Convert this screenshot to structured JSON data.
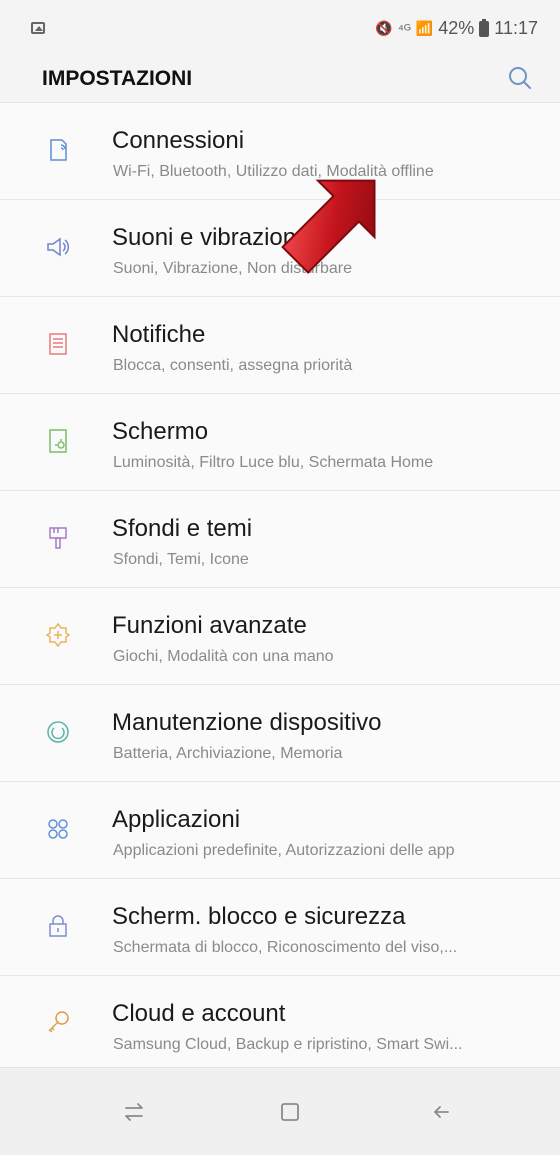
{
  "status_bar": {
    "left_icon": "image-notification-icon",
    "mute_icon": "mute-icon",
    "signal_label": "⁴ᴳ",
    "signal_icon": "signal-icon",
    "battery": "42%",
    "battery_icon": "battery-icon",
    "time": "11:17"
  },
  "header": {
    "title": "IMPOSTAZIONI",
    "search_icon": "search-icon"
  },
  "settings": [
    {
      "title": "Connessioni",
      "subtitle": "Wi-Fi, Bluetooth, Utilizzo dati, Modalità offline",
      "icon": "connections-icon"
    },
    {
      "title": "Suoni e vibrazione",
      "subtitle": "Suoni, Vibrazione, Non disturbare",
      "icon": "speaker-icon"
    },
    {
      "title": "Notifiche",
      "subtitle": "Blocca, consenti, assegna priorità",
      "icon": "notifications-icon"
    },
    {
      "title": "Schermo",
      "subtitle": "Luminosità, Filtro Luce blu, Schermata Home",
      "icon": "display-icon"
    },
    {
      "title": "Sfondi e temi",
      "subtitle": "Sfondi, Temi, Icone",
      "icon": "paintbrush-icon"
    },
    {
      "title": "Funzioni avanzate",
      "subtitle": "Giochi, Modalità con una mano",
      "icon": "advanced-features-icon"
    },
    {
      "title": "Manutenzione dispositivo",
      "subtitle": "Batteria, Archiviazione, Memoria",
      "icon": "device-maintenance-icon"
    },
    {
      "title": "Applicazioni",
      "subtitle": "Applicazioni predefinite, Autorizzazioni delle app",
      "icon": "apps-icon"
    },
    {
      "title": "Scherm. blocco e sicurezza",
      "subtitle": "Schermata di blocco, Riconoscimento del viso,...",
      "icon": "lock-icon"
    },
    {
      "title": "Cloud e account",
      "subtitle": "Samsung Cloud, Backup e ripristino, Smart Swi...",
      "icon": "key-icon"
    }
  ],
  "navigation": {
    "recent_icon": "recent-apps-icon",
    "home_icon": "home-icon",
    "back_icon": "back-icon"
  },
  "colors": {
    "background": "#f4f4f4",
    "list_background": "#fafafa",
    "arrow": "#c4141c",
    "connections": "#5b8fd6",
    "speaker": "#6e86c9",
    "notifications": "#e97b7b",
    "display": "#7cbd68",
    "paintbrush": "#a77bc7",
    "advanced": "#e8b65c",
    "maintenance": "#58b5a8",
    "apps": "#5f91d8",
    "lock": "#7d8fd0",
    "key": "#df9c4c"
  }
}
